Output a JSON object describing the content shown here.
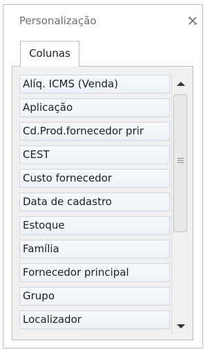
{
  "panel": {
    "title": "Personalização"
  },
  "tab": {
    "label": "Colunas"
  },
  "columns": [
    "Alíq. ICMS (Venda)",
    "Aplicação",
    "Cd.Prod.fornecedor prir",
    "CEST",
    "Custo fornecedor",
    "Data de cadastro",
    "Estoque",
    "Família",
    "Fornecedor principal",
    "Grupo",
    "Localizador"
  ],
  "icons": {
    "close": "close-icon",
    "scroll_up": "chevron-up-icon",
    "scroll_down": "chevron-down-icon",
    "grip": "scroll-grip-icon"
  },
  "colors": {
    "item_border": "#c9d6e6",
    "item_background": "#f3f6fa",
    "text": "#1e1e1e"
  }
}
